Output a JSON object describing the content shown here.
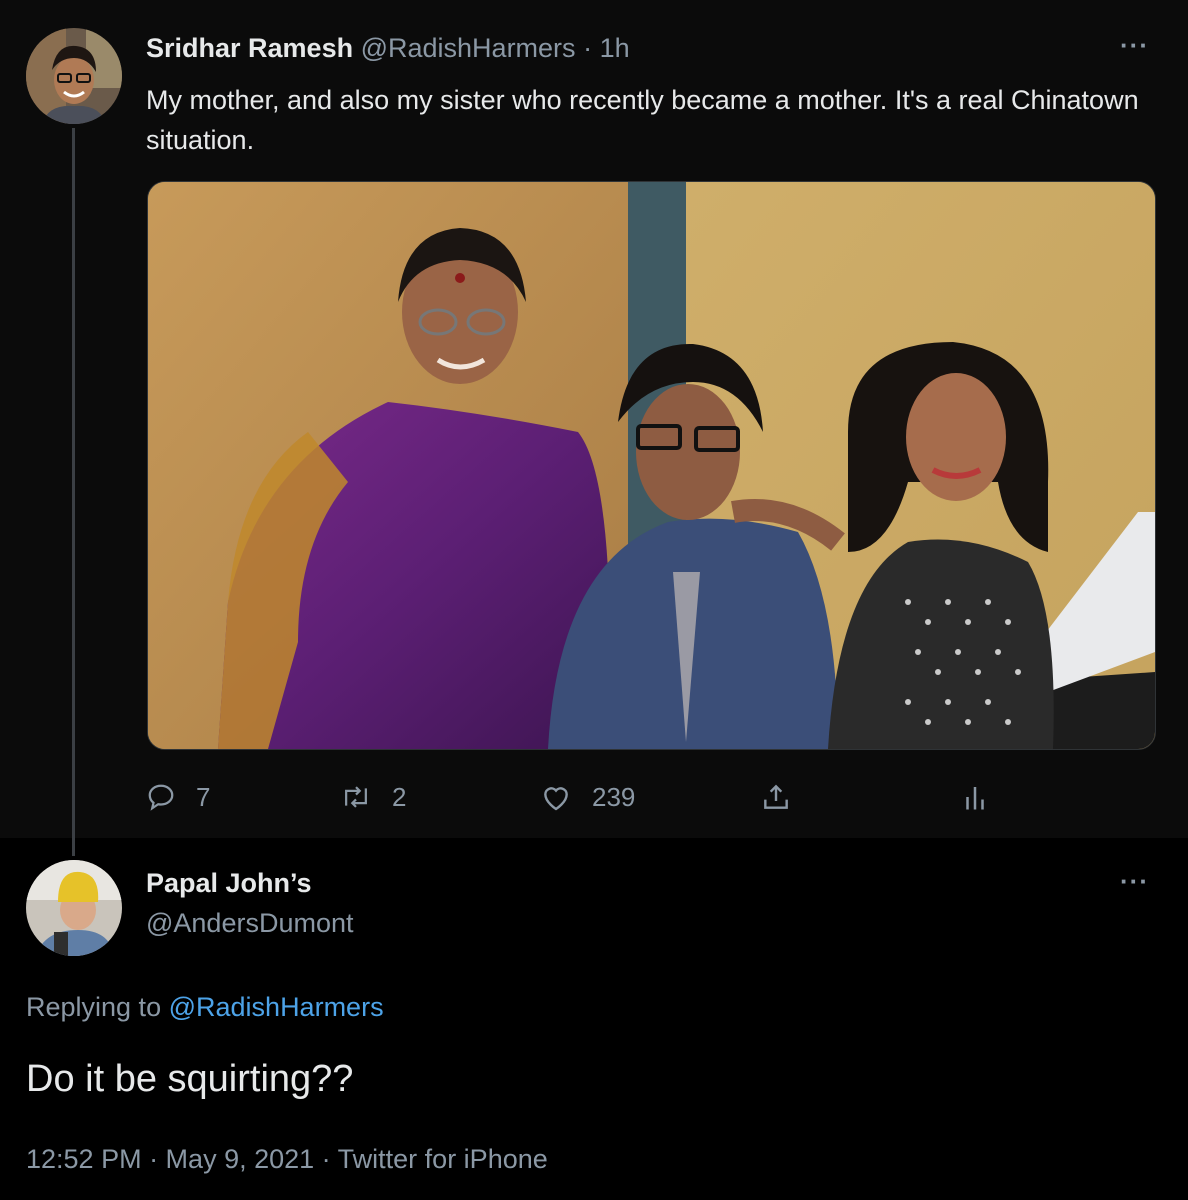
{
  "tweet": {
    "author_name": "Sridhar Ramesh",
    "author_handle": "@RadishHarmers",
    "time": "· 1h",
    "text": "My mother, and also my sister who recently became a mother. It's a real Chinatown situation.",
    "more_label": "···",
    "stats": {
      "replies": "7",
      "retweets": "2",
      "likes": "239"
    }
  },
  "reply": {
    "author_name": "Papal John’s",
    "author_handle": "@AndersDumont",
    "more_label": "···",
    "replying_prefix": "Replying to",
    "replying_mention": "@RadishHarmers",
    "text": "Do it be squirting??",
    "meta": "12:52 PM · May 9, 2021 · Twitter for iPhone"
  },
  "colors": {
    "background": "#000000",
    "thread_background": "#0b0b0b",
    "text_primary": "#e7e9ea",
    "text_secondary": "#8b98a5",
    "link": "#4da3e8"
  },
  "icons": {
    "reply": "reply-icon",
    "retweet": "retweet-icon",
    "like": "heart-icon",
    "share": "share-icon",
    "analytics": "analytics-icon",
    "more": "more-icon"
  }
}
